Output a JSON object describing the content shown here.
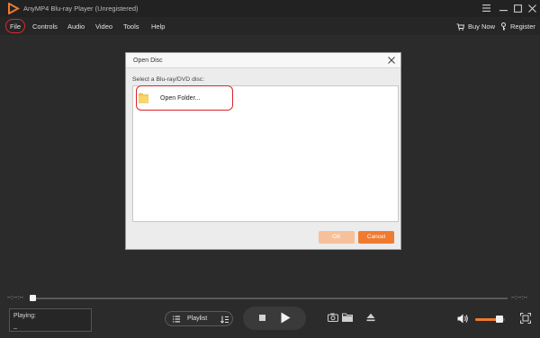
{
  "window": {
    "title": "AnyMP4 Blu-ray Player (Unregistered)",
    "accent_color": "#f07a2f",
    "highlight_color": "#e2262c"
  },
  "menubar": {
    "items": [
      "File",
      "Controls",
      "Audio",
      "Video",
      "Tools",
      "Help"
    ],
    "buy_now": "Buy Now",
    "register": "Register"
  },
  "dialog": {
    "title": "Open Disc",
    "label": "Select a Blu-ray/DVD disc:",
    "items": [
      {
        "label": "Open Folder...",
        "icon": "folder-icon"
      }
    ],
    "ok_label": "OK",
    "cancel_label": "Cancel"
  },
  "player": {
    "time_elapsed": "--:--:--",
    "time_total": "--:--:--",
    "playing_label": "Playing:",
    "playing_value": "_",
    "playlist_label": "Playlist",
    "progress": 0.0,
    "volume": 0.82
  }
}
